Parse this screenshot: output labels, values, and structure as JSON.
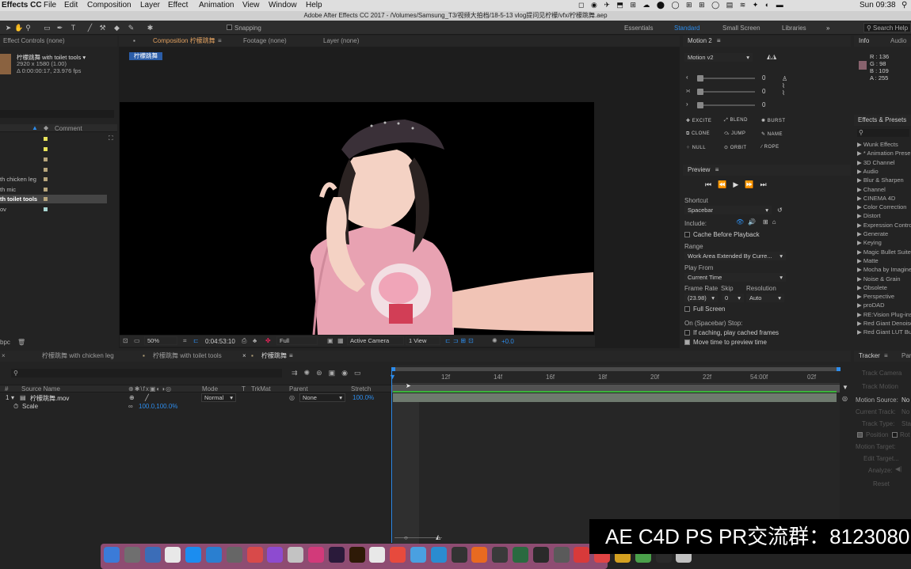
{
  "menubar": {
    "app": "Effects CC",
    "items": [
      "File",
      "Edit",
      "Composition",
      "Layer",
      "Effect",
      "Animation",
      "View",
      "Window",
      "Help"
    ],
    "clock": "Sun 09:38"
  },
  "titlebar": {
    "text": "Adobe After Effects CC 2017 - /Volumes/Samsung_T3/视频大拍档/18-5-13 vlog提问见柠檬/vfx/柠檬跳舞.aep"
  },
  "toolbar": {
    "snapping": "Snapping",
    "workspaces": [
      "Essentials",
      "Standard",
      "Small Screen",
      "Libraries"
    ],
    "active_workspace": "Standard",
    "search_help": "Search Help"
  },
  "project": {
    "effect_controls": "Effect Controls (none)",
    "item_name": "柠檬跳舞 with toilet tools ▾",
    "item_dims": "2920 x 1580 (1.00)",
    "item_dur": "Δ 0:00:00:17, 23.976 fps",
    "col_comment": "Comment",
    "rows": [
      "",
      "",
      "",
      "",
      "th chicken leg",
      "th mic",
      "th toilet tools",
      "ov"
    ],
    "bpc": "bpc"
  },
  "comp": {
    "tab_comp": "Composition 柠檬跳舞",
    "tab_footage": "Footage (none)",
    "tab_layer": "Layer (none)",
    "comp_name_tag": "柠檬跳舞",
    "zoom": "50%",
    "timecode": "0:04:53:10",
    "resolution": "Full",
    "camera": "Active Camera",
    "views": "1 View",
    "exposure": "+0.0"
  },
  "motion": {
    "title": "Motion 2",
    "preset": "Motion v2",
    "slider_values": [
      "0",
      "0",
      "0"
    ],
    "buttons": [
      "EXCITE",
      "BLEND",
      "BURST",
      "CLONE",
      "JUMP",
      "NAME",
      "NULL",
      "ORBIT",
      "ROPE"
    ]
  },
  "preview": {
    "title": "Preview",
    "shortcut_lbl": "Shortcut",
    "shortcut": "Spacebar",
    "include": "Include:",
    "cache": "Cache Before Playback",
    "range_lbl": "Range",
    "range": "Work Area Extended By Curre...",
    "playfrom_lbl": "Play From",
    "playfrom": "Current Time",
    "fr_lbl": "Frame Rate",
    "skip_lbl": "Skip",
    "res_lbl": "Resolution",
    "fr": "(23.98)",
    "skip": "0",
    "res": "Auto",
    "fullscreen": "Full Screen",
    "stop_lbl": "On (Spacebar) Stop:",
    "stop1": "If caching, play cached frames",
    "stop2": "Move time to preview time"
  },
  "info": {
    "tab_info": "Info",
    "tab_audio": "Audio",
    "r": "R : 136",
    "g": "G : 98",
    "b": "B : 109",
    "a": "A : 255",
    "color": "#88626d"
  },
  "effects": {
    "title": "Effects & Presets",
    "items": [
      "Wunk Effects",
      "* Animation Prese",
      "3D Channel",
      "Audio",
      "Blur & Sharpen",
      "Channel",
      "CINEMA 4D",
      "Color Correction",
      "Distort",
      "Expression Contro",
      "Generate",
      "Keying",
      "Magic Bullet Suite",
      "Matte",
      "Mocha by Imagine",
      "Noise & Grain",
      "Obsolete",
      "Perspective",
      "proDAD",
      "RE:Vision Plug-ins",
      "Red Giant Denoise",
      "Red Giant LUT Bu"
    ]
  },
  "timeline": {
    "tabs": [
      "柠檬跳舞 with chicken leg",
      "柠檬跳舞 with toilet tools",
      "柠檬跳舞"
    ],
    "cols": {
      "num": "#",
      "source": "Source Name",
      "mode": "Mode",
      "t": "T",
      "trkmat": "TrkMat",
      "parent": "Parent",
      "stretch": "Stretch"
    },
    "layer_num": "1",
    "layer_name": "柠檬跳舞.mov",
    "layer_mode": "Normal",
    "layer_parent": "None",
    "layer_stretch": "100.0%",
    "prop_name": "Scale",
    "prop_value": "100.0,100.0%",
    "ruler": [
      "12f",
      "14f",
      "16f",
      "18f",
      "20f",
      "22f",
      "54:00f",
      "02f"
    ]
  },
  "tracker": {
    "title": "Tracker",
    "tab2": "Par",
    "track_camera": "Track Camera",
    "track_motion": "Track Motion",
    "motion_source": "Motion Source:",
    "motion_source_val": "No",
    "current_track": "Current Track:",
    "current_track_val": "No",
    "track_type": "Track Type:",
    "track_type_val": "Sta",
    "position": "Position",
    "rotation": "Rot",
    "motion_target": "Motion Target:",
    "edit_target": "Edit Target...",
    "analyze": "Analyze:",
    "reset": "Reset"
  },
  "banner": {
    "text": "AE C4D PS PR交流群：8123080"
  }
}
